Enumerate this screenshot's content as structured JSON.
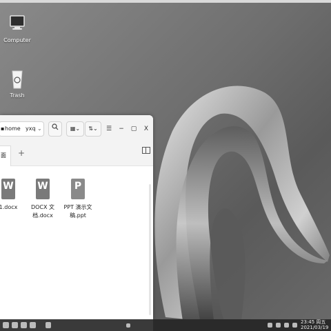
{
  "desktop": {
    "icons": [
      {
        "label": "Computer",
        "icon": "computer-icon"
      },
      {
        "label": "Trash",
        "icon": "trash-icon"
      }
    ]
  },
  "file_manager": {
    "breadcrumb": {
      "home": "home",
      "user": "yxq"
    },
    "toolbar": {
      "search_icon": "search-icon",
      "view_icon": "grid-view-icon",
      "sort_icon": "sort-icon",
      "menu_icon": "menu-icon",
      "minimize": "−",
      "maximize": "▢",
      "close": "X"
    },
    "tab_label": "面",
    "new_tab": "+",
    "files": [
      {
        "name": "1.docx",
        "type": "docx",
        "glyph": "W",
        "color": "#7a7a7a"
      },
      {
        "name": "DOCX 文档.docx",
        "type": "docx",
        "glyph": "W",
        "color": "#7a7a7a"
      },
      {
        "name": "PPT 演示文稿.ppt",
        "type": "ppt",
        "glyph": "P",
        "color": "#8a8a8a"
      }
    ]
  },
  "taskbar": {
    "clock": {
      "time": "23:45 周五",
      "date": "2021/03/19"
    }
  }
}
